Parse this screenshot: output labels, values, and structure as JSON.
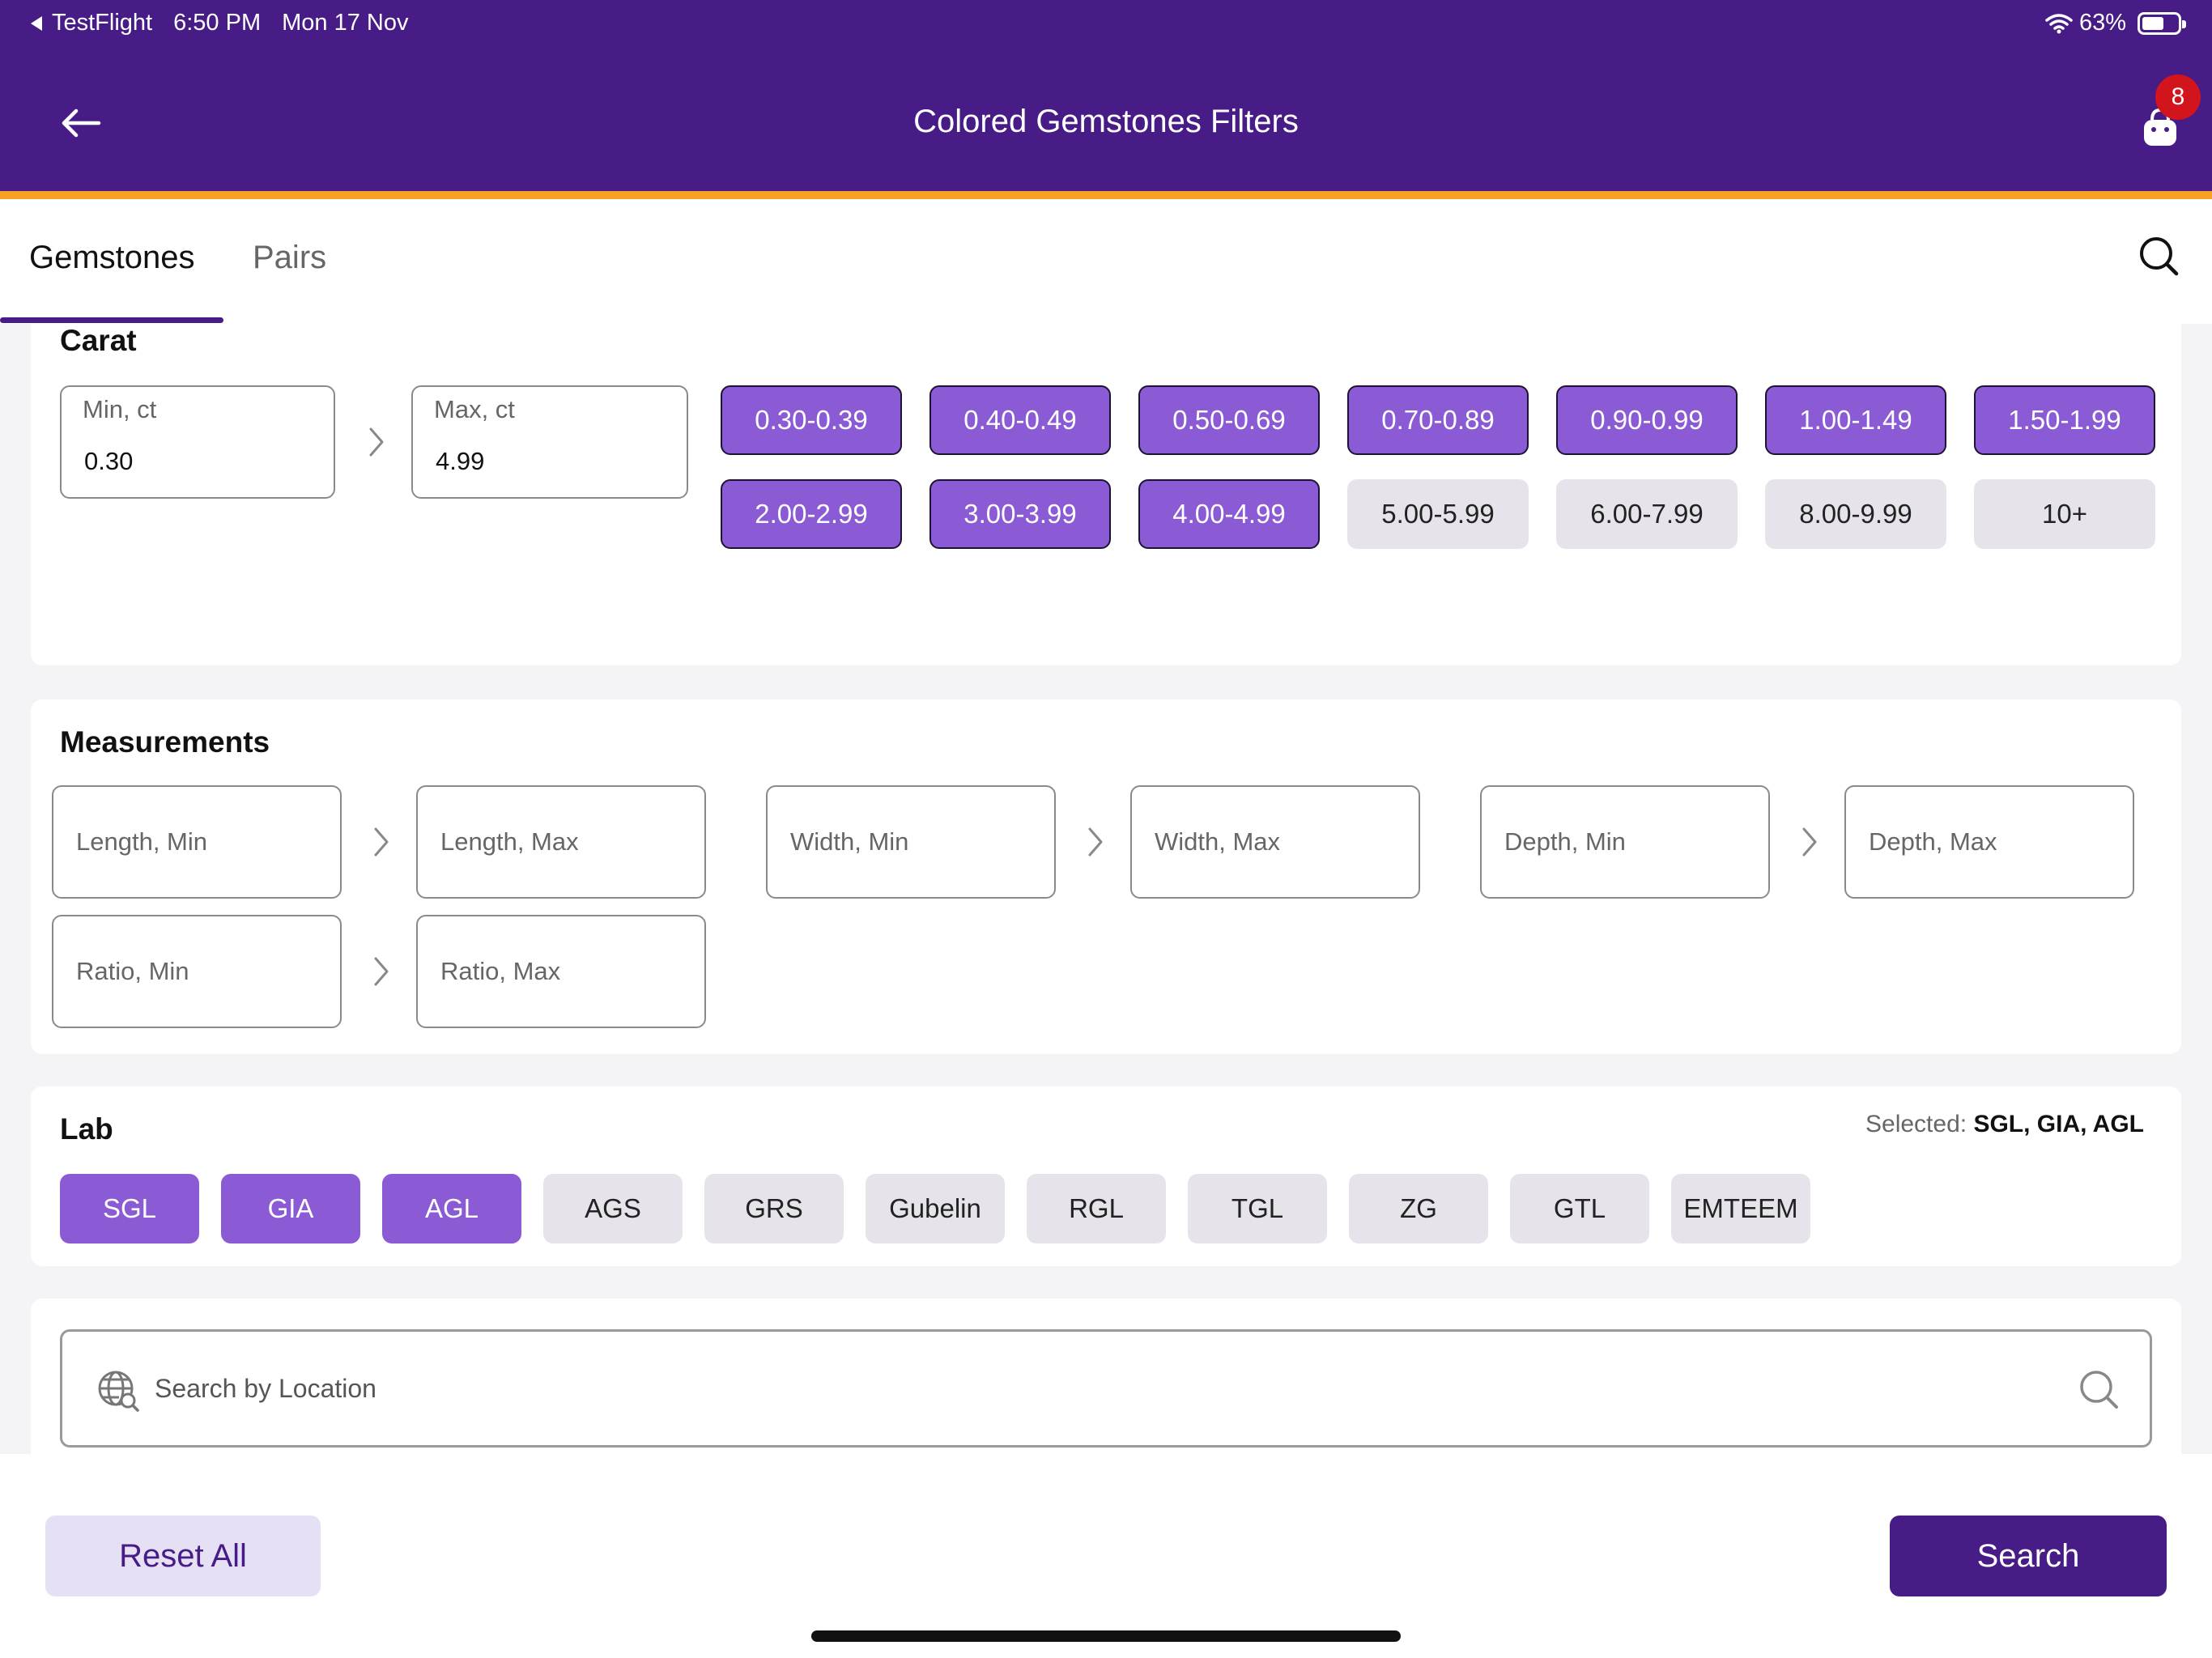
{
  "status_bar": {
    "back_app": "TestFlight",
    "time": "6:50 PM",
    "date": "Mon 17 Nov",
    "battery": "63%",
    "battery_level": 0.63
  },
  "header": {
    "title": "Colored Gemstones Filters",
    "cart_count": "8"
  },
  "tabs": [
    {
      "label": "Gemstones",
      "active": true
    },
    {
      "label": "Pairs",
      "active": false
    }
  ],
  "carat": {
    "title": "Carat",
    "min": {
      "label": "Min, ct",
      "value": "0.30"
    },
    "max": {
      "label": "Max, ct",
      "value": "4.99"
    },
    "ranges": [
      {
        "label": "0.30-0.39",
        "selected": true
      },
      {
        "label": "0.40-0.49",
        "selected": true
      },
      {
        "label": "0.50-0.69",
        "selected": true
      },
      {
        "label": "0.70-0.89",
        "selected": true
      },
      {
        "label": "0.90-0.99",
        "selected": true
      },
      {
        "label": "1.00-1.49",
        "selected": true
      },
      {
        "label": "1.50-1.99",
        "selected": true
      },
      {
        "label": "2.00-2.99",
        "selected": true
      },
      {
        "label": "3.00-3.99",
        "selected": true
      },
      {
        "label": "4.00-4.99",
        "selected": true
      },
      {
        "label": "5.00-5.99",
        "selected": false
      },
      {
        "label": "6.00-7.99",
        "selected": false
      },
      {
        "label": "8.00-9.99",
        "selected": false
      },
      {
        "label": "10+",
        "selected": false
      }
    ]
  },
  "measurements": {
    "title": "Measurements",
    "length_min": "Length, Min",
    "length_max": "Length, Max",
    "width_min": "Width, Min",
    "width_max": "Width, Max",
    "depth_min": "Depth, Min",
    "depth_max": "Depth, Max",
    "ratio_min": "Ratio, Min",
    "ratio_max": "Ratio, Max"
  },
  "lab": {
    "title": "Lab",
    "selected_label": "Selected:",
    "selected_value": "SGL, GIA, AGL",
    "options": [
      {
        "label": "SGL",
        "selected": true
      },
      {
        "label": "GIA",
        "selected": true
      },
      {
        "label": "AGL",
        "selected": true
      },
      {
        "label": "AGS",
        "selected": false
      },
      {
        "label": "GRS",
        "selected": false
      },
      {
        "label": "Gubelin",
        "selected": false
      },
      {
        "label": "RGL",
        "selected": false
      },
      {
        "label": "TGL",
        "selected": false
      },
      {
        "label": "ZG",
        "selected": false
      },
      {
        "label": "GTL",
        "selected": false
      },
      {
        "label": "EMTEEM",
        "selected": false
      }
    ]
  },
  "location": {
    "placeholder": "Search by Location"
  },
  "footer": {
    "reset_label": "Reset All",
    "search_label": "Search"
  }
}
